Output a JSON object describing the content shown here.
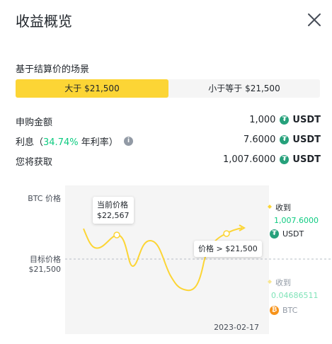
{
  "header": {
    "title": "收益概览",
    "close_icon": "close-icon"
  },
  "scenario": {
    "label": "基于结算价的场景",
    "tabs": [
      {
        "label": "大于 $21,500",
        "active": true
      },
      {
        "label": "小于等于 $21,500",
        "active": false
      }
    ]
  },
  "summary": {
    "subscription": {
      "label": "申购金额",
      "value": "1,000",
      "currency": "USDT"
    },
    "interest": {
      "label_prefix": "利息（",
      "rate": "34.74%",
      "label_suffix": " 年利率）",
      "value": "7.6000",
      "currency": "USDT"
    },
    "receive": {
      "label": "您将获取",
      "value": "1,007.6000",
      "currency": "USDT"
    }
  },
  "chart": {
    "y_axis_label": "BTC 价格",
    "target_label": "目标价格",
    "target_value": "$21,500",
    "current_tooltip": {
      "title": "当前价格",
      "value": "$22,567"
    },
    "condition_tooltip": "价格 > $21,500",
    "date": "2023-02-17",
    "above": {
      "label": "收到",
      "amount": "1,007.6000",
      "currency": "USDT"
    },
    "below": {
      "label": "收到",
      "amount": "0.04686511",
      "currency": "BTC"
    },
    "colors": {
      "line": "#fcd535",
      "green": "#0ecb81",
      "muted_yellow": "#f8e68f",
      "muted_green": "#7fe3b8"
    }
  },
  "chart_data": {
    "type": "line",
    "x": [],
    "target_price": 21500,
    "current_price": 22567,
    "date": "2023-02-17"
  }
}
